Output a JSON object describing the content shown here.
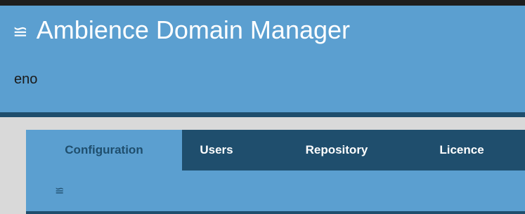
{
  "header": {
    "menu_icon_glyph": "≌",
    "title": "Ambience Domain Manager",
    "domain": "eno"
  },
  "tabs": [
    {
      "label": "Configuration",
      "active": true
    },
    {
      "label": "Users",
      "active": false
    },
    {
      "label": "Repository",
      "active": false
    },
    {
      "label": "Licence",
      "active": false
    }
  ],
  "panel": {
    "menu_icon_glyph": "≌"
  },
  "colors": {
    "header_bg": "#5b9fd0",
    "dark_navy": "#1f4e6d",
    "page_bg": "#d9d9d9",
    "top_strip": "#1e1e1e"
  }
}
